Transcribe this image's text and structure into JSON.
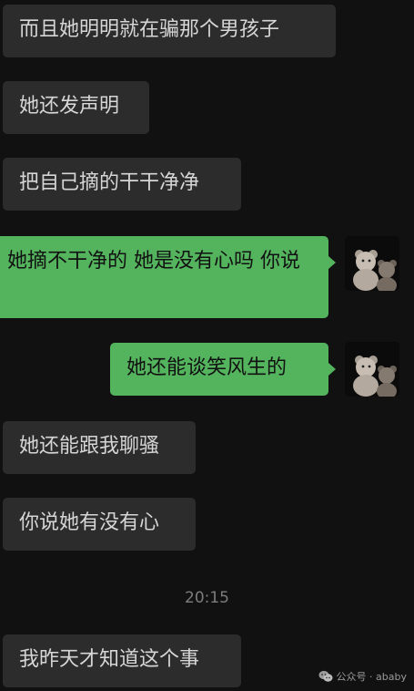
{
  "conversation": {
    "messages": [
      {
        "side": "received",
        "text": "而且她明明就在骗那个男孩子"
      },
      {
        "side": "received",
        "text": "她还发声明"
      },
      {
        "side": "received",
        "text": "把自己摘的干干净净"
      },
      {
        "side": "sent",
        "text": "她摘不干净的 她是没有心吗 你说"
      },
      {
        "side": "sent",
        "text": "她还能谈笑风生的"
      },
      {
        "side": "received",
        "text": "她还能跟我聊骚"
      },
      {
        "side": "received",
        "text": "你说她有没有心"
      },
      {
        "side": "received",
        "text": "我昨天才知道这个事"
      }
    ],
    "timestamp": "20:15"
  },
  "avatar": {
    "icon": "teddy-bears-avatar"
  },
  "watermark": {
    "icon": "wechat-icon",
    "text": "公众号 · ababy"
  },
  "colors": {
    "background": "#111111",
    "received_bubble": "#2c2c2c",
    "sent_bubble": "#54b35d"
  }
}
